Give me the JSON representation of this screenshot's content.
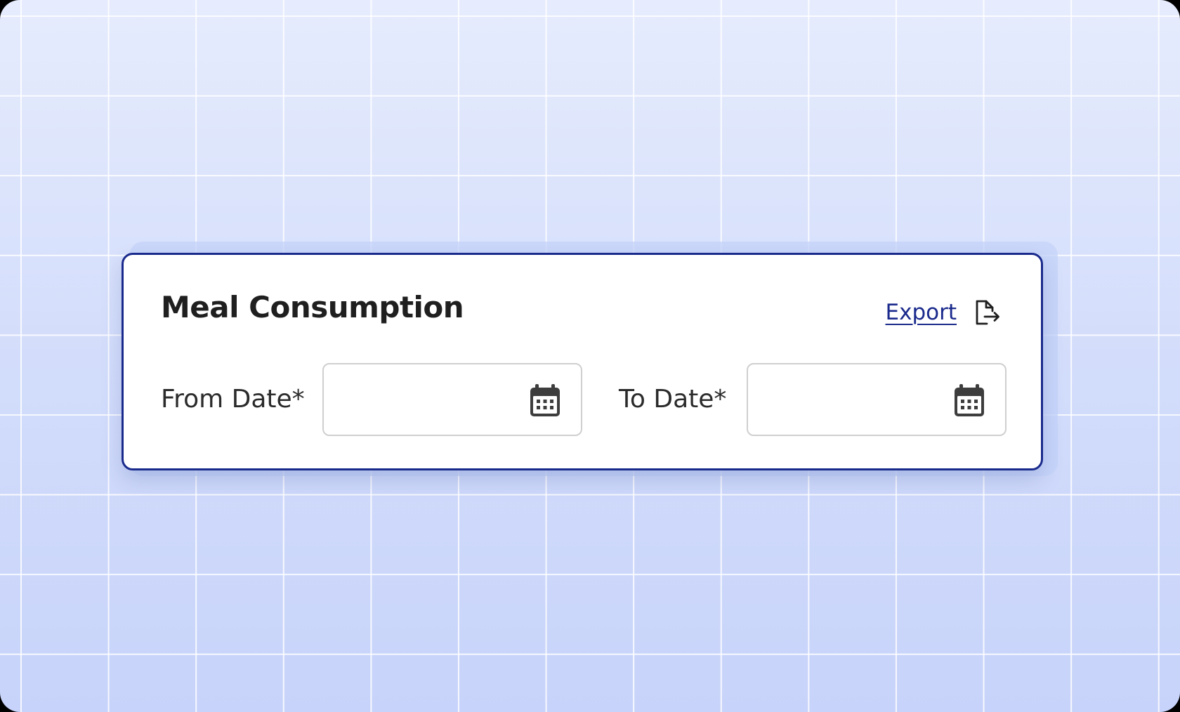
{
  "card": {
    "title": "Meal Consumption",
    "export_label": "Export"
  },
  "filters": {
    "from_date": {
      "label": "From Date*",
      "value": "",
      "placeholder": "",
      "icon": "calendar-icon"
    },
    "to_date": {
      "label": "To Date*",
      "value": "",
      "placeholder": "",
      "icon": "calendar-icon"
    }
  },
  "icons": {
    "export": "file-export-icon"
  },
  "colors": {
    "accent": "#1a2a8c",
    "title_text": "#1f1f1f",
    "input_border": "#cfcfcf",
    "background": "#d6e0fb"
  }
}
